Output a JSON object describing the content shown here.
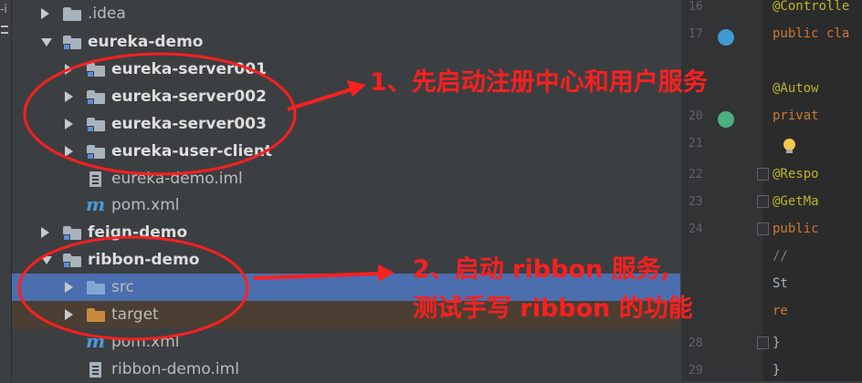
{
  "project_tree": {
    "items": [
      {
        "label": ".idea",
        "arrow": "right",
        "icon": "folder-gray",
        "bold": false
      },
      {
        "label": "eureka-demo",
        "arrow": "down",
        "icon": "folder-module",
        "bold": true
      },
      {
        "label": "eureka-server001",
        "arrow": "right",
        "icon": "folder-module",
        "bold": true
      },
      {
        "label": "eureka-server002",
        "arrow": "right",
        "icon": "folder-module",
        "bold": true
      },
      {
        "label": "eureka-server003",
        "arrow": "right",
        "icon": "folder-module",
        "bold": true
      },
      {
        "label": "eureka-user-client",
        "arrow": "right",
        "icon": "folder-module",
        "bold": true
      },
      {
        "label": "eureka-demo.iml",
        "arrow": "none",
        "icon": "iml-file",
        "bold": false
      },
      {
        "label": "pom.xml",
        "arrow": "none",
        "icon": "maven-m-icon",
        "bold": false
      },
      {
        "label": "feign-demo",
        "arrow": "right",
        "icon": "folder-module",
        "bold": true
      },
      {
        "label": "ribbon-demo",
        "arrow": "down",
        "icon": "folder-module",
        "bold": true
      },
      {
        "label": "src",
        "arrow": "right",
        "icon": "folder-source",
        "bold": false,
        "state": "selected"
      },
      {
        "label": "target",
        "arrow": "right",
        "icon": "folder-excluded",
        "bold": false,
        "state": "excluded"
      },
      {
        "label": "pom.xml",
        "arrow": "none",
        "icon": "maven-m-icon",
        "bold": false
      },
      {
        "label": "ribbon-demo.iml",
        "arrow": "none",
        "icon": "iml-file",
        "bold": false
      }
    ],
    "maven_glyph": "m",
    "selected_color": "#4b6eaf"
  },
  "editor": {
    "line_numbers": [
      "16",
      "17",
      "",
      "",
      "20",
      "21",
      "22",
      "23",
      "24",
      "",
      "",
      "",
      "28",
      "29"
    ],
    "lines": [
      {
        "text": "@Controlle",
        "style": "ann"
      },
      {
        "text": "public cla",
        "style": "kw"
      },
      {
        "text": "",
        "style": "plain"
      },
      {
        "text": "    @Autow",
        "style": "ann"
      },
      {
        "text": "    privat",
        "style": "kw"
      },
      {
        "text": "",
        "style": "plain"
      },
      {
        "text": "    @Respo",
        "style": "ann"
      },
      {
        "text": "    @GetMa",
        "style": "ann"
      },
      {
        "text": "    public",
        "style": "kw"
      },
      {
        "text": "        //",
        "style": "comment"
      },
      {
        "text": "        St",
        "style": "plain"
      },
      {
        "text": "        re",
        "style": "kw"
      },
      {
        "text": "    }",
        "style": "plain"
      },
      {
        "text": "}",
        "style": "plain"
      }
    ],
    "gutter_icon_colors": [
      "#3d9ad1",
      "#4caf7d"
    ]
  },
  "annotations": {
    "note1": "1、先启动注册中心和用户服务",
    "note2_line1": "2、启动 ribbon 服务,",
    "note2_line2": "测试手写 ribbon 的功能",
    "color": "#ff2020"
  }
}
